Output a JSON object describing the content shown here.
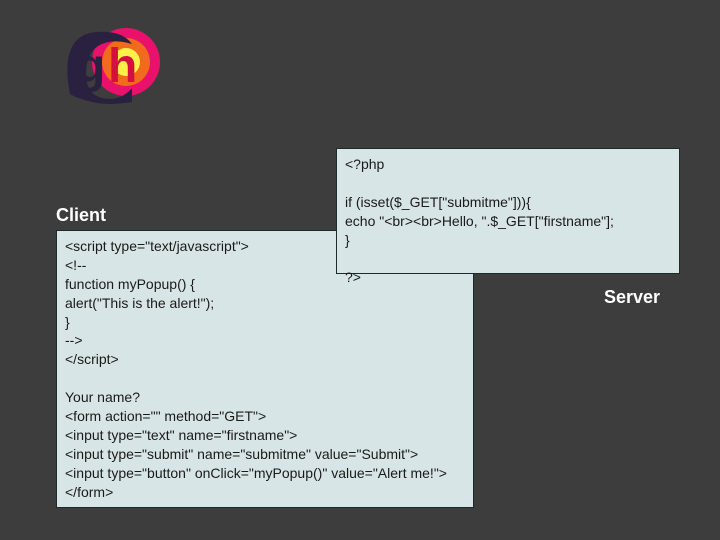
{
  "logo": {
    "letters": "gh"
  },
  "labels": {
    "client": "Client",
    "server": "Server"
  },
  "code": {
    "client": "<script type=\"text/javascript\">\n<!--\nfunction myPopup() {\nalert(\"This is the alert!\");\n}\n-->\n</script>\n\nYour name?\n<form action=\"\" method=\"GET\">\n<input type=\"text\" name=\"firstname\">\n<input type=\"submit\" name=\"submitme\" value=\"Submit\">\n<input type=\"button\" onClick=\"myPopup()\" value=\"Alert me!\">\n</form>",
    "server": "<?php\n\nif (isset($_GET[\"submitme\"])){\necho \"<br><br>Hello, \".$_GET[\"firstname\"];\n}\n\n?>"
  }
}
